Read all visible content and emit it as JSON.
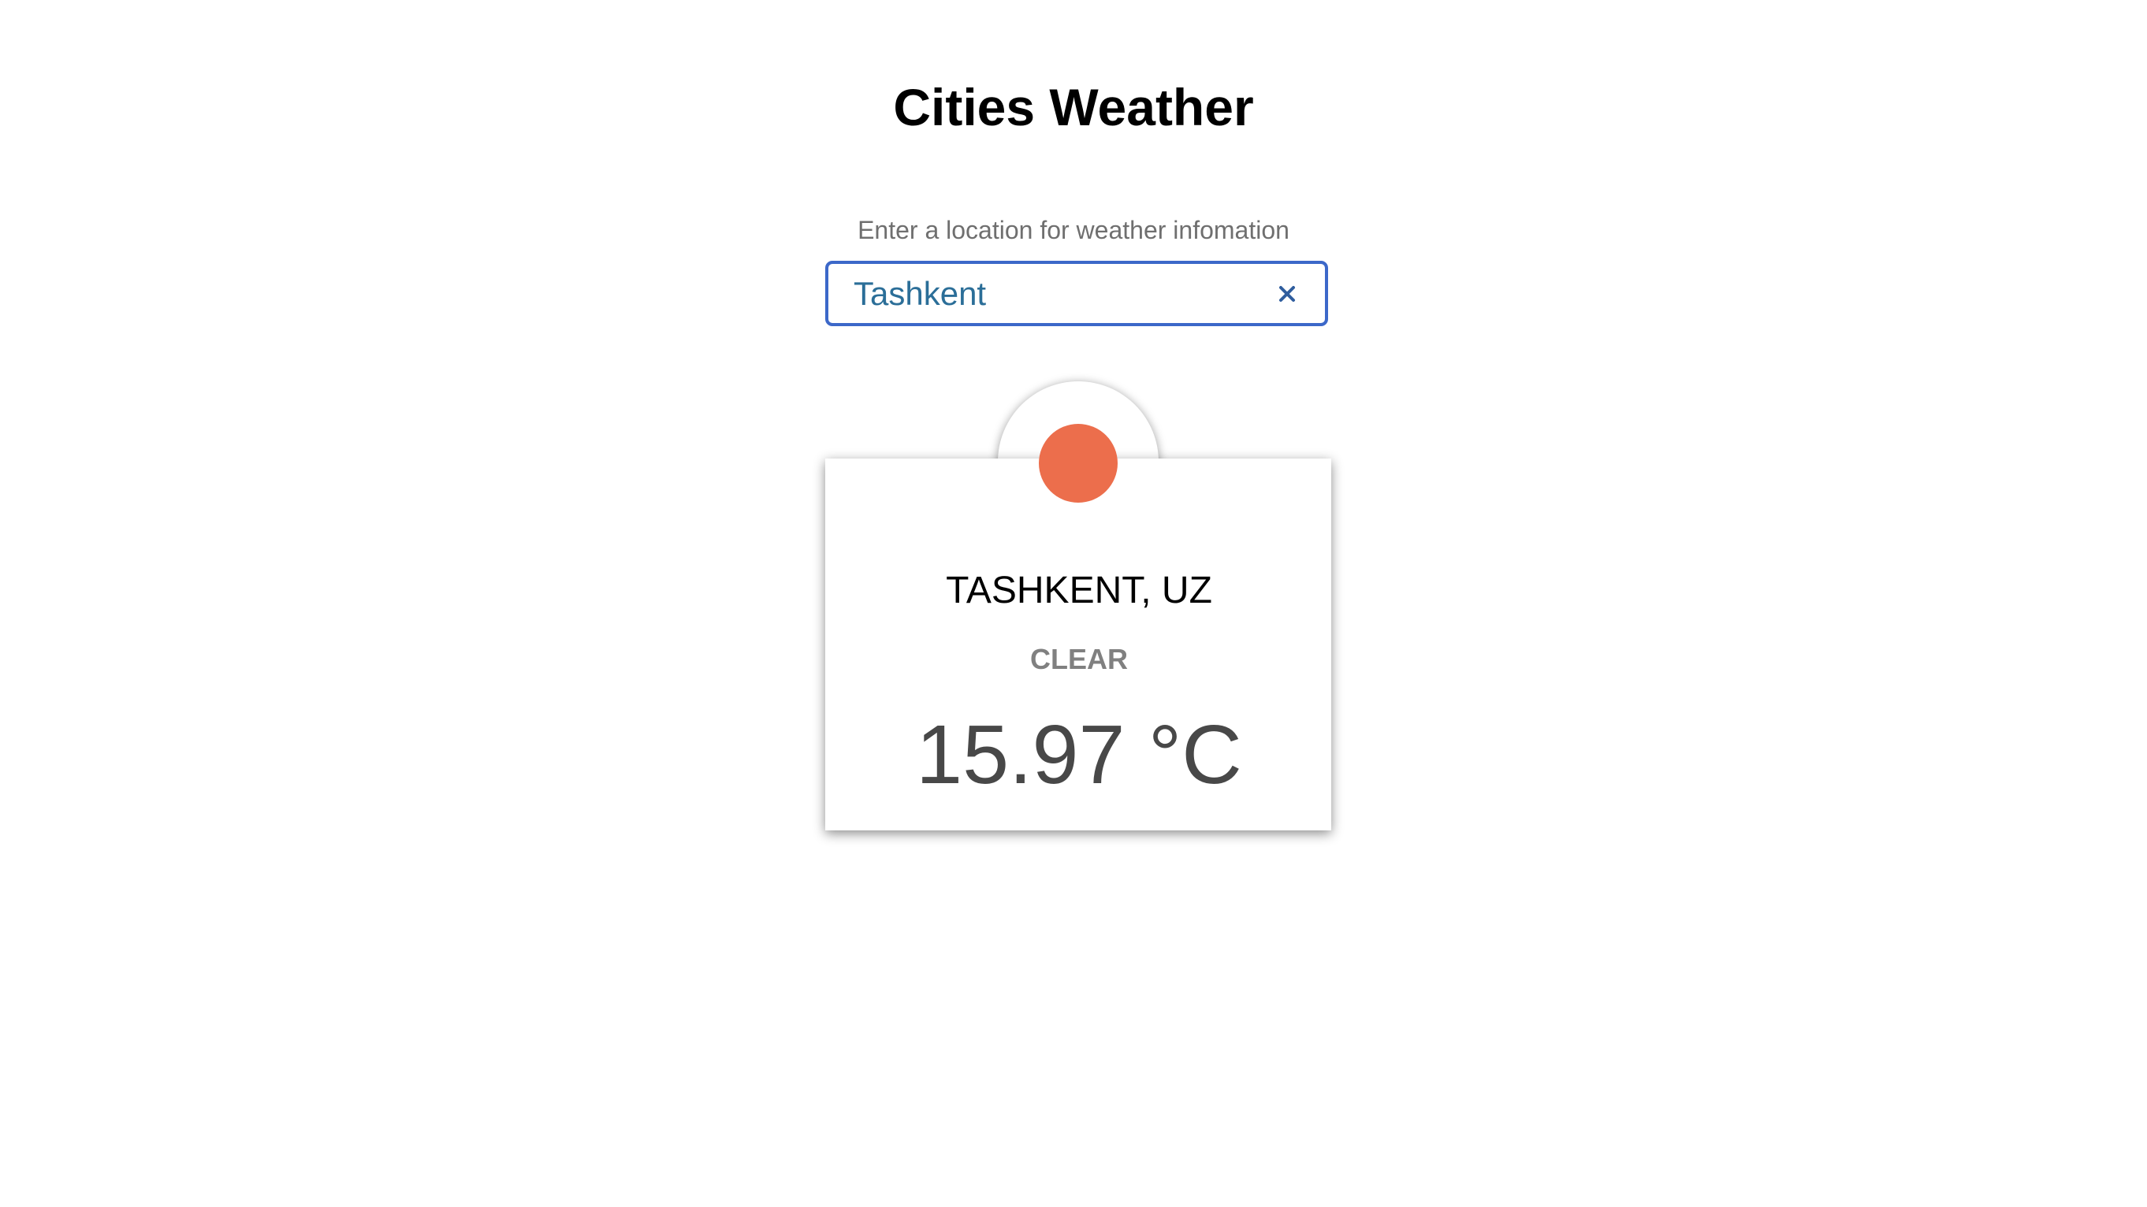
{
  "app": {
    "title": "Cities Weather"
  },
  "search": {
    "prompt": "Enter a location for weather infomation",
    "value": "Tashkent",
    "clear_icon": "close-icon"
  },
  "weather_card": {
    "icon": "sun-icon",
    "icon_color": "#ec6e4c",
    "location": "TASHKENT, UZ",
    "condition": "CLEAR",
    "temperature": "15.97 °C"
  },
  "colors": {
    "input_border": "#3c68c9",
    "input_text": "#2b6e98"
  }
}
